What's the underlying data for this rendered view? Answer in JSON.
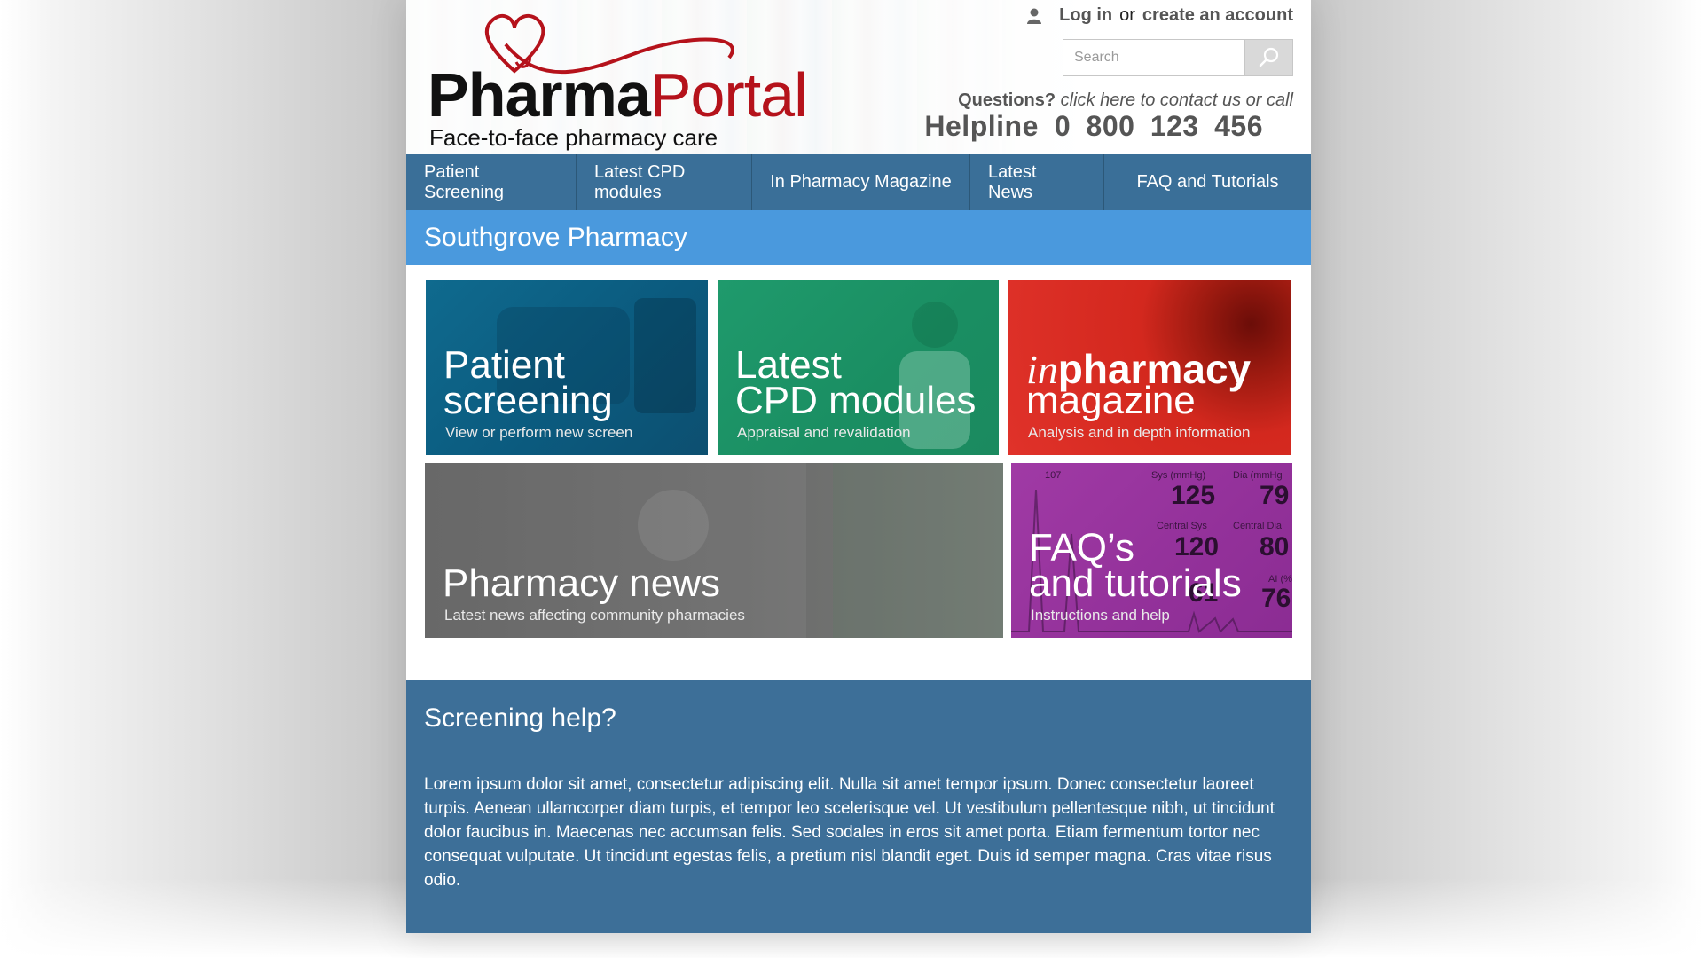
{
  "header": {
    "logo": {
      "word_pharma": "Pharma",
      "word_portal": "Portal",
      "tagline": "Face-to-face pharmacy care",
      "brand_red": "#b5121b"
    },
    "account": {
      "icon": "user-icon",
      "login_label": "Log in",
      "or_label": "or",
      "create_label": "create an account"
    },
    "search": {
      "placeholder": "Search",
      "value": "",
      "icon": "search-icon"
    },
    "questions": {
      "label": "Questions?",
      "contact_text": "click here to contact us or call"
    },
    "helpline": {
      "label": "Helpline",
      "number": "0 800  123  456"
    }
  },
  "nav": {
    "items": [
      {
        "label": "Patient Screening"
      },
      {
        "label": "Latest CPD modules"
      },
      {
        "label": "In Pharmacy Magazine"
      },
      {
        "label": "Latest News"
      },
      {
        "label": "FAQ and Tutorials"
      }
    ],
    "background": "#3a6f98"
  },
  "page_title": "Southgrove Pharmacy",
  "tiles": {
    "patient_screening": {
      "title_line1": "Patient",
      "title_line2": "screening",
      "subtitle": "View or perform new screen",
      "color": "#0f6a8e"
    },
    "cpd": {
      "title_line1": "Latest",
      "title_line2": "CPD modules",
      "subtitle": "Appraisal and revalidation",
      "color": "#1f9a6c"
    },
    "magazine": {
      "title_in": "in",
      "title_pharmacy": "pharmacy",
      "title_line2": "magazine",
      "subtitle": "Analysis and in depth information",
      "color": "#d3281e"
    },
    "news": {
      "title": "Pharmacy news",
      "subtitle": "Latest news affecting community pharmacies",
      "color": "#5c5c5c"
    },
    "faq": {
      "title_line1": "FAQ’s",
      "title_line2": "and tutorials",
      "subtitle": "Instructions and help",
      "color": "#a03aa5",
      "monitor": {
        "sys_label": "Sys (mmHg)",
        "dia_label": "Dia (mmHg",
        "sys_value": "125",
        "dia_value": "79",
        "central_sys_label": "Central Sys",
        "central_dia_label": "Central Dia",
        "central_sys_value": "120",
        "central_dia_value": "80",
        "ai_label": "AI (%",
        "value_61": "61",
        "value_76": "76",
        "value_107": "107"
      }
    }
  },
  "help_panel": {
    "title": "Screening help?",
    "body": "Lorem ipsum dolor sit amet, consectetur adipiscing elit. Nulla sit amet tempor ipsum. Donec consectetur laoreet turpis. Aenean ullamcorper diam turpis, et tempor leo scelerisque vel. Ut vestibulum pellentesque nibh, ut tincidunt dolor faucibus in. Maecenas nec accumsan felis. Sed sodales in eros sit amet porta. Etiam fermentum tortor nec consequat vulputate. Ut tincidunt egestas felis, a pretium nisl blandit eget. Duis id semper magna. Cras vitae risus odio.",
    "background": "#3d6f98"
  }
}
